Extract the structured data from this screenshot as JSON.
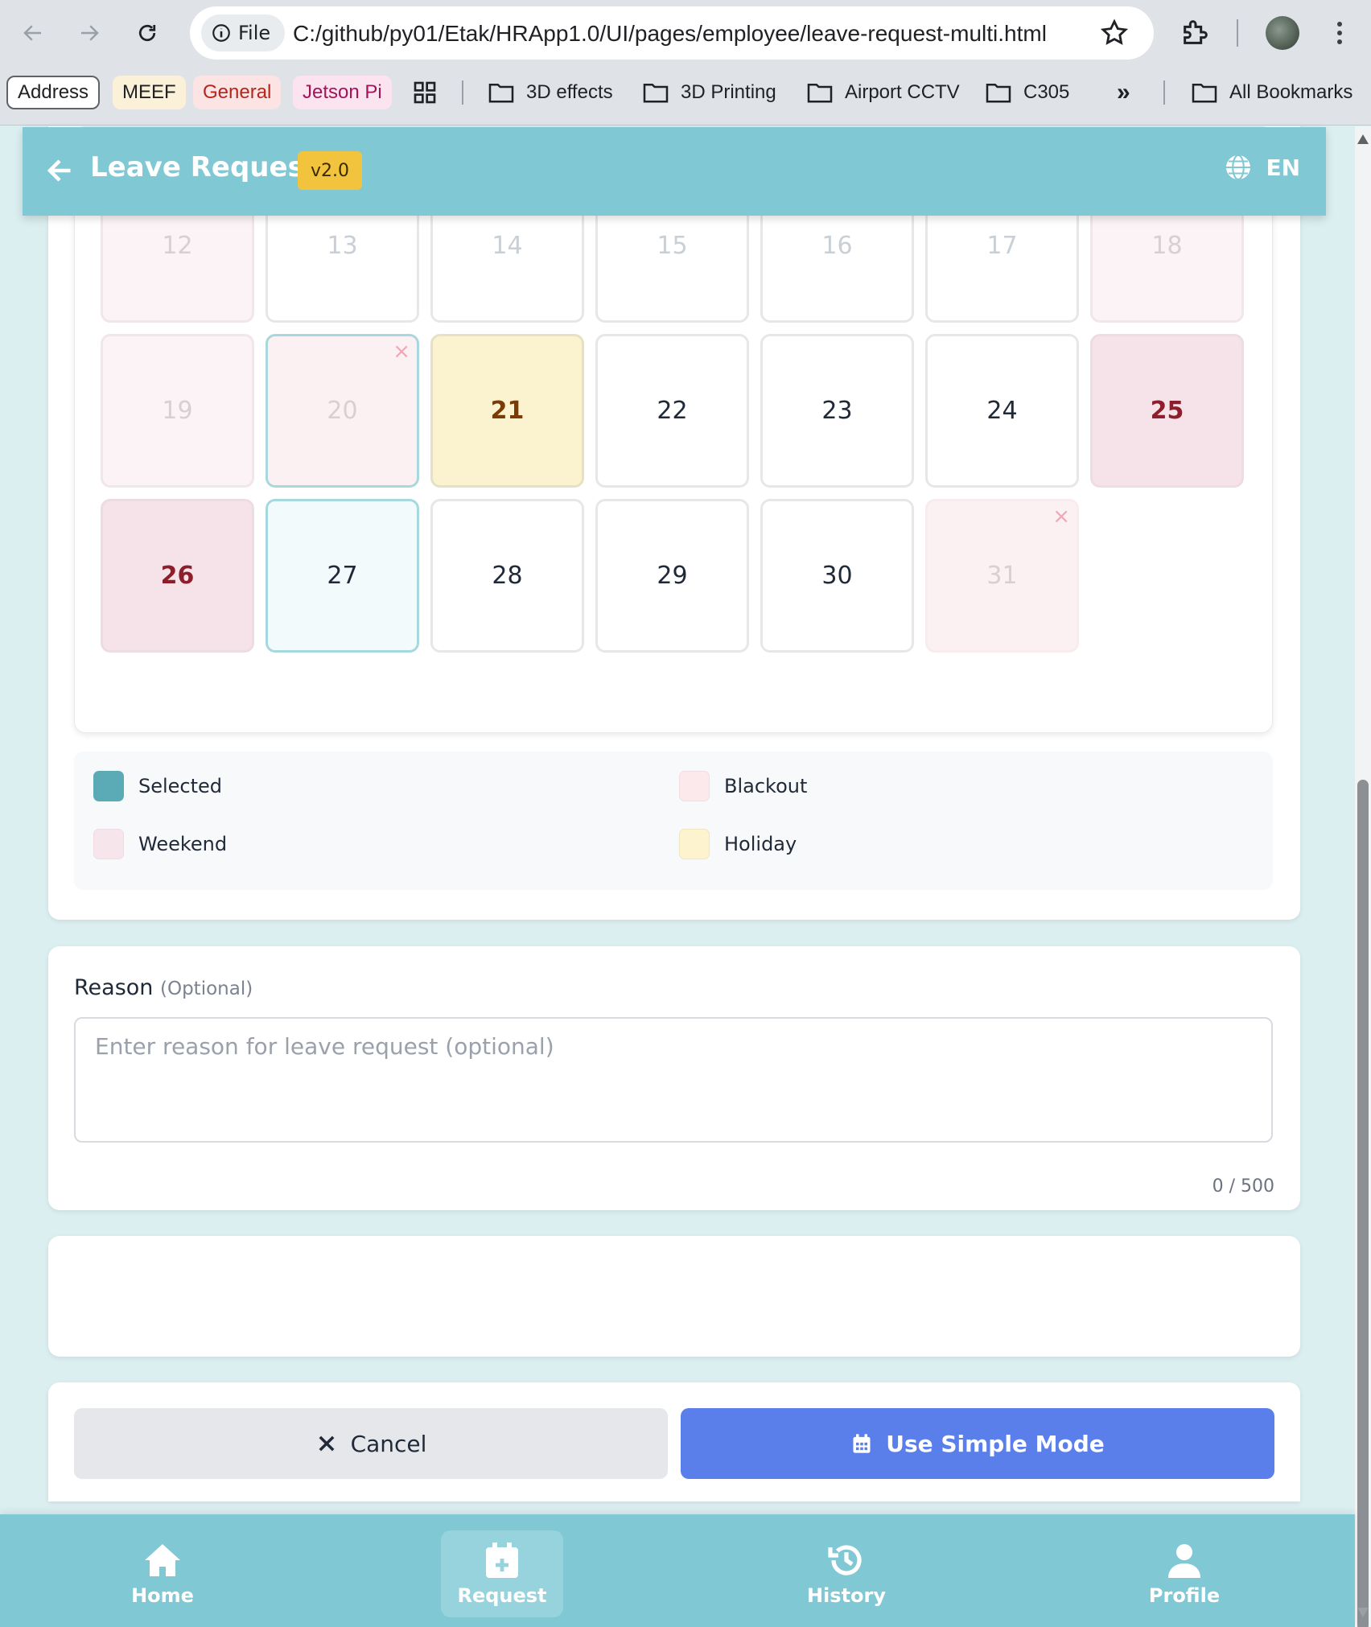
{
  "browser": {
    "file_chip": "File",
    "url": "C:/github/py01/Etak/HRApp1.0/UI/pages/employee/leave-request-multi.html",
    "bookmarks": [
      {
        "label": "Address"
      },
      {
        "label": "MEEF"
      },
      {
        "label": "General"
      },
      {
        "label": "Jetson Pi"
      },
      {
        "label": "3D effects"
      },
      {
        "label": "3D Printing"
      },
      {
        "label": "Airport CCTV"
      },
      {
        "label": "C305"
      },
      {
        "label": "»"
      },
      {
        "label": "All Bookmarks"
      }
    ],
    "colors": {
      "meef_bg": "#fbf1d9",
      "general_bg": "#fbe4e3",
      "general_fg": "#b3261e",
      "jetson_bg": "#fbe4ef",
      "jetson_fg": "#a0145a"
    }
  },
  "header": {
    "title": "Leave Request",
    "version": "v2.0",
    "language": "EN",
    "bg_color": "#80c8d4"
  },
  "calendar": {
    "days": [
      {
        "label": "12",
        "state": "weekend-past"
      },
      {
        "label": "13",
        "state": "disabled"
      },
      {
        "label": "14",
        "state": "disabled"
      },
      {
        "label": "15",
        "state": "disabled"
      },
      {
        "label": "16",
        "state": "disabled"
      },
      {
        "label": "17",
        "state": "disabled"
      },
      {
        "label": "18",
        "state": "weekend-past"
      },
      {
        "label": "19",
        "state": "weekend-past"
      },
      {
        "label": "20",
        "state": "blackout-ringed",
        "mark": "×"
      },
      {
        "label": "21",
        "state": "holiday"
      },
      {
        "label": "22",
        "state": "available"
      },
      {
        "label": "23",
        "state": "available"
      },
      {
        "label": "24",
        "state": "available"
      },
      {
        "label": "25",
        "state": "weekend"
      },
      {
        "label": "26",
        "state": "weekend"
      },
      {
        "label": "27",
        "state": "today"
      },
      {
        "label": "28",
        "state": "available"
      },
      {
        "label": "29",
        "state": "available"
      },
      {
        "label": "30",
        "state": "available"
      },
      {
        "label": "31",
        "state": "blackout",
        "mark": "×"
      }
    ]
  },
  "legend": {
    "selected": {
      "label": "Selected",
      "color": "#5aabb6"
    },
    "blackout": {
      "label": "Blackout",
      "color": "#fbe9ec"
    },
    "weekend": {
      "label": "Weekend",
      "color": "#f7e5ec"
    },
    "holiday": {
      "label": "Holiday",
      "color": "#fdf3cf"
    }
  },
  "reason": {
    "label": "Reason",
    "optional": "(Optional)",
    "placeholder": "Enter reason for leave request (optional)",
    "value": "",
    "counter": "0 / 500"
  },
  "actions": {
    "cancel": "Cancel",
    "simple_mode": "Use Simple Mode",
    "simple_color": "#5b7fea"
  },
  "bottom_nav": {
    "home": "Home",
    "request": "Request",
    "history": "History",
    "profile": "Profile",
    "active": "request"
  }
}
